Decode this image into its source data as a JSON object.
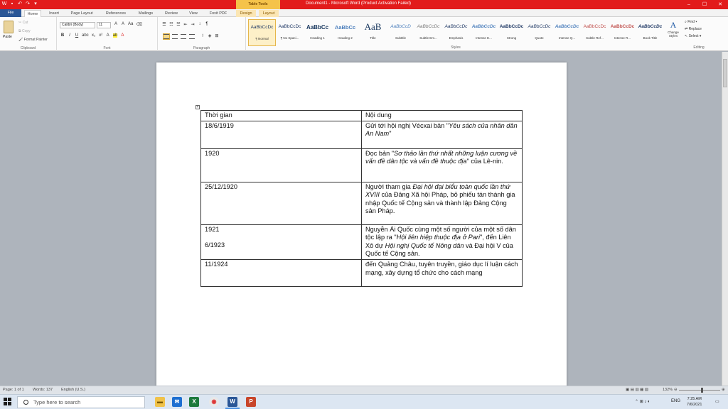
{
  "window": {
    "doc_title": "Document1 - Microsoft Word (Product Activation Failed)",
    "context_tools": "Table Tools"
  },
  "tabs": [
    "File",
    "Home",
    "Insert",
    "Page Layout",
    "References",
    "Mailings",
    "Review",
    "View",
    "Foxit PDF",
    "Design",
    "Layout"
  ],
  "ribbon": {
    "clipboard": {
      "paste": "Paste",
      "cut": "Cut",
      "copy": "Copy",
      "format_painter": "Format Painter",
      "label": "Clipboard"
    },
    "font": {
      "name": "Calibri (Body)",
      "size": "11",
      "label": "Font"
    },
    "paragraph": {
      "label": "Paragraph"
    },
    "styles": {
      "label": "Styles",
      "items": [
        {
          "sample": "AaBbCcDc",
          "name": "¶ Normal"
        },
        {
          "sample": "AaBbCcDc",
          "name": "¶ No Spaci..."
        },
        {
          "sample": "AaBbCc",
          "name": "Heading 1"
        },
        {
          "sample": "AaBbCc",
          "name": "Heading 2"
        },
        {
          "sample": "AaB",
          "name": "Title"
        },
        {
          "sample": "AaBbCcD",
          "name": "Subtitle"
        },
        {
          "sample": "AaBbCcDc",
          "name": "Subtle Em..."
        },
        {
          "sample": "AaBbCcDc",
          "name": "Emphasis"
        },
        {
          "sample": "AaBbCcDc",
          "name": "Intense E..."
        },
        {
          "sample": "AaBbCcDc",
          "name": "Strong"
        },
        {
          "sample": "AaBbCcDc",
          "name": "Quote"
        },
        {
          "sample": "AaBbCcDc",
          "name": "Intense Q..."
        },
        {
          "sample": "AaBbCcDc",
          "name": "Subtle Ref..."
        },
        {
          "sample": "AaBbCcDc",
          "name": "Intense R..."
        },
        {
          "sample": "AaBbCcDc",
          "name": "Book Title"
        }
      ],
      "change_styles": "Change Styles"
    },
    "editing": {
      "label": "Editing",
      "find": "Find",
      "replace": "Replace",
      "select": "Select"
    }
  },
  "table": {
    "header": {
      "col1": "Thời gian",
      "col2": "Nội dung"
    },
    "rows": [
      {
        "date": "18/6/1919",
        "pre": "Gửi tới hội nghị Vécxai bản \"",
        "it": "Yêu sách của nhân dân An Nam",
        "post": "\""
      },
      {
        "date": "1920",
        "pre": "Đọc bản \"",
        "it": "Sơ thảo lần thứ nhất những luận cương về vấn đề dân tộc và vấn đề thuộc địa",
        "post": "\" của Lê-nin."
      },
      {
        "date": "25/12/1920",
        "pre": "Người tham gia ",
        "it": "Đại hội đại biểu toàn quốc lần thứ XVIII",
        "post": " của Đảng Xã hội Pháp, bỏ phiếu tán thành gia nhập Quốc tế Cộng sản và thành lập Đảng Cộng sản Pháp."
      },
      {
        "date": "1921",
        "date2": "6/1923",
        "pre": "Nguyễn Ái Quốc cùng một số người của một số dân tộc lập ra \"",
        "it": "Hội liên hiệp thuộc địa ở Pari",
        "post": "\", ",
        "pre2": "đến Liên Xô dự ",
        "it2": "Hội nghị Quốc tế Nông dân",
        "post2": " và Đại hội V của Quốc tế Cộng sản."
      },
      {
        "date": "11/1924",
        "pre": "đến Quảng Châu, tuyên truyền, giáo dục lí luận cách mạng, xây dựng tổ chức cho cách mạng",
        "it": "",
        "post": ""
      }
    ]
  },
  "status": {
    "page": "Page: 1 of 1",
    "words": "Words: 137",
    "lang": "English (U.S.)",
    "zoom": "132%"
  },
  "taskbar": {
    "search_placeholder": "Type here to search",
    "lang": "ENG",
    "time": "7:25 AM",
    "date": "7/6/2021"
  }
}
